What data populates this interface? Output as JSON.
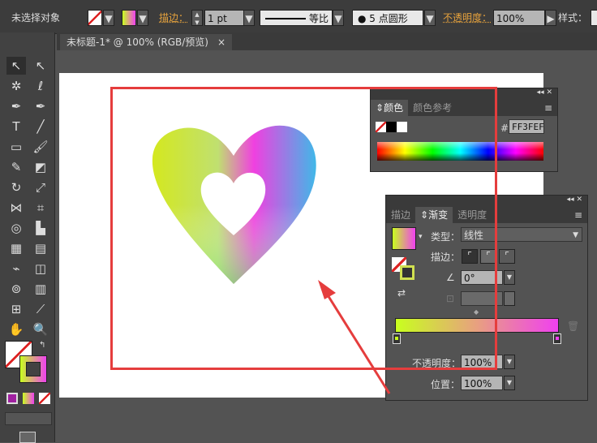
{
  "control_bar": {
    "selection": "未选择对象",
    "stroke_label": "描边：",
    "stroke_weight": "1 pt",
    "stroke_profile": "等比",
    "brush": "5 点圆形",
    "opacity_label": "不透明度：",
    "opacity": "100%",
    "style_label": "样式："
  },
  "document_tab": {
    "title": "未标题-1* @ 100% (RGB/预览)",
    "close": "×"
  },
  "color_panel": {
    "tabs": [
      "颜色",
      "颜色参考"
    ],
    "hex_label": "#",
    "hex": "FF3FEF"
  },
  "gradient_panel": {
    "tabs": [
      "描边",
      "渐变",
      "透明度"
    ],
    "type_label": "类型：",
    "type_value": "线性",
    "stroke_label": "描边：",
    "angle": "0°",
    "opacity_label": "不透明度：",
    "opacity": "100%",
    "location_label": "位置：",
    "location": "100%",
    "start_color": "#c8ff1e",
    "end_color": "#f040f0"
  },
  "colors": {
    "annotation": "#e53d3d",
    "heart_left": "#d4e81e",
    "heart_right": "#40b8e8",
    "heart_mid": "#f040e0"
  }
}
